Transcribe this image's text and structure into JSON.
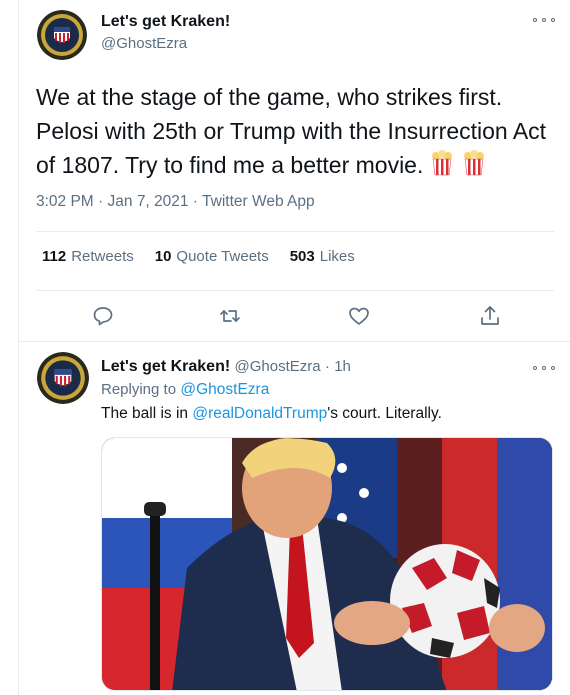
{
  "main_tweet": {
    "display_name": "Let's get Kraken!",
    "handle": "@GhostEzra",
    "text": "We at the stage of the game, who strikes first. Pelosi with 25th or Trump with the Insurrection Act of 1807. Try to find me a better movie.",
    "emojis": [
      "popcorn-icon",
      "popcorn-icon"
    ],
    "time": "3:02 PM",
    "date": "Jan 7, 2021",
    "source": "Twitter Web App",
    "stats": [
      {
        "count": "112",
        "label": "Retweets"
      },
      {
        "count": "10",
        "label": "Quote Tweets"
      },
      {
        "count": "503",
        "label": "Likes"
      }
    ],
    "actions": [
      "reply-icon",
      "retweet-icon",
      "like-icon",
      "share-icon"
    ]
  },
  "reply_tweet": {
    "display_name": "Let's get Kraken!",
    "handle": "@GhostEzra",
    "separator": "·",
    "age": "1h",
    "replying_to_label": "Replying to",
    "replying_to_handle": "@GhostEzra",
    "text_before": "The ball is in ",
    "mention": "@realDonaldTrump",
    "text_after": "'s court. Literally."
  },
  "colors": {
    "link": "#1b95e0",
    "secondary": "#5b7083",
    "border": "#e6ecf0"
  }
}
